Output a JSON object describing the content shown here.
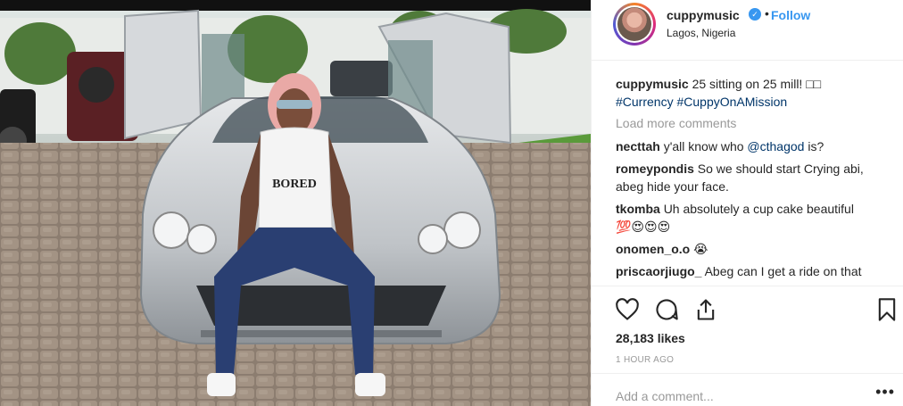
{
  "post": {
    "username": "cuppymusic",
    "verified_mark": "✓",
    "separator": "•",
    "follow_label": "Follow",
    "location": "Lagos, Nigeria",
    "shirt_text": "BORED"
  },
  "caption": {
    "username": "cuppymusic",
    "text": "25 sitting on 25 mill! ",
    "emoji": "□□",
    "tag1": "#Currency",
    "tag2": "#CuppyOnAMission"
  },
  "load_more_label": "Load more comments",
  "comments": [
    {
      "username": "necttah",
      "text": "y'all know who ",
      "mention": "@cthagod",
      "after": " is?"
    },
    {
      "username": "romeypondis",
      "text": "So we should start Crying abi, abeg hide your face."
    },
    {
      "username": "tkomba",
      "text": "Uh absolutely a cup cake beautiful ",
      "emoji": "💯😍😍😍"
    },
    {
      "username": "onomen_o.o",
      "text": "",
      "emoji": "😭"
    },
    {
      "username": "priscaorjiugo_",
      "text": "Abeg can I get a ride on that"
    }
  ],
  "icons": [
    "heart-icon",
    "comment-icon",
    "share-icon",
    "bookmark-icon"
  ],
  "likes": "28,183 likes",
  "timestamp": "1 HOUR AGO",
  "add_comment_placeholder": "Add a comment...",
  "more_options": "•••",
  "colors": {
    "link": "#3897f0",
    "tag": "#003569",
    "muted": "#999999",
    "text": "#262626"
  }
}
